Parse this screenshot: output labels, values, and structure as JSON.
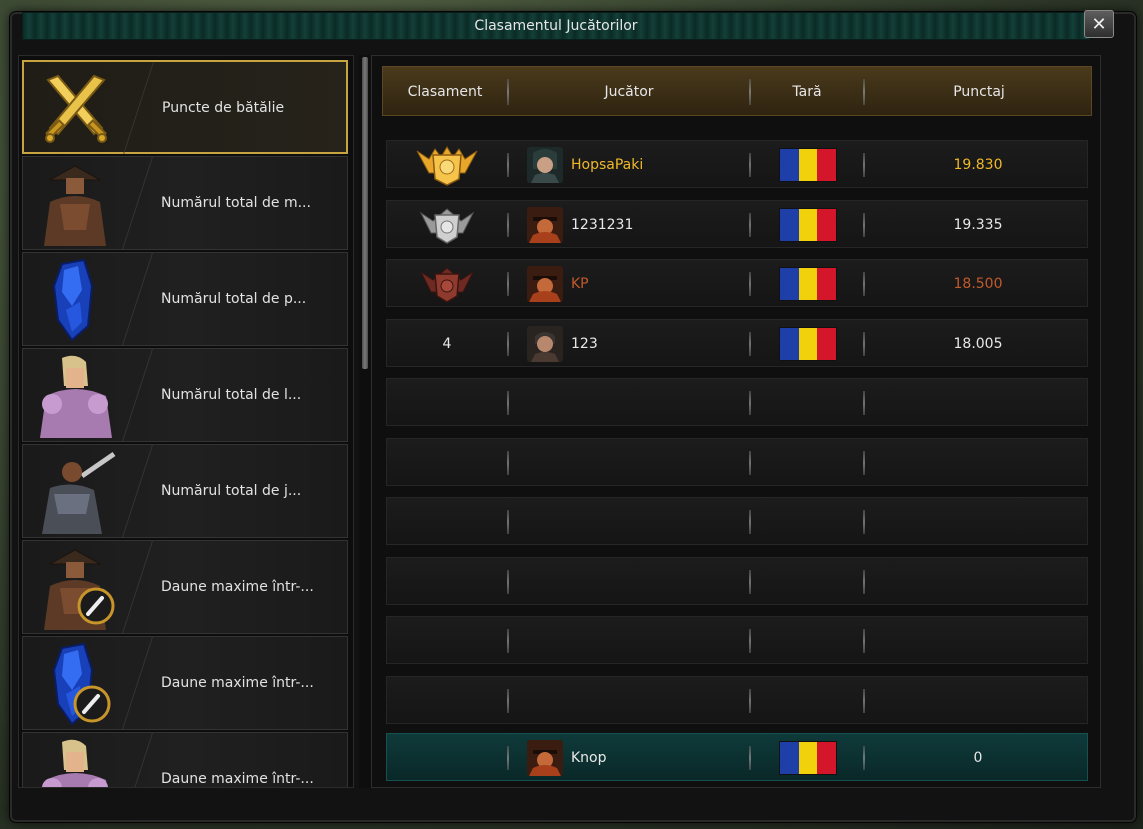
{
  "window": {
    "title": "Clasamentul Jucătorilor",
    "close_label": "✕"
  },
  "sidebar": {
    "items": [
      {
        "label": "Puncte de bătălie",
        "icon": "crossed-swords-icon",
        "active": true
      },
      {
        "label": "Numărul total de m...",
        "icon": "straw-hat-warrior-icon"
      },
      {
        "label": "Numărul total de p...",
        "icon": "blue-crystal-icon"
      },
      {
        "label": "Numărul total de l...",
        "icon": "paladin-icon"
      },
      {
        "label": "Numărul total de j...",
        "icon": "swordsman-icon"
      },
      {
        "label": "Daune maxime într-...",
        "icon": "straw-hat-warrior-sword-icon"
      },
      {
        "label": "Daune maxime într-...",
        "icon": "blue-crystal-sword-icon"
      },
      {
        "label": "Daune maxime într-...",
        "icon": "paladin-icon"
      }
    ]
  },
  "table": {
    "headers": {
      "rank": "Clasament",
      "player": "Jucător",
      "country": "Tară",
      "score": "Punctaj"
    },
    "rows": [
      {
        "rank": "",
        "rank_icon": "gold-medal-icon",
        "player": "HopsaPaki",
        "score": "19.830",
        "color": "#f0b92a",
        "avatar": "female-avatar"
      },
      {
        "rank": "",
        "rank_icon": "silver-medal-icon",
        "player": "1231231",
        "score": "19.335",
        "color": "#e8e8e8",
        "avatar": "warrior-avatar"
      },
      {
        "rank": "",
        "rank_icon": "bronze-medal-icon",
        "player": "KP",
        "score": "18.500",
        "color": "#c25a2a",
        "avatar": "warrior-avatar"
      },
      {
        "rank": "4",
        "rank_icon": "",
        "player": "123",
        "score": "18.005",
        "color": "#e8e8e8",
        "avatar": "male-avatar"
      }
    ],
    "empty_rows": 6,
    "self_row": {
      "player": "Knop",
      "score": "0",
      "avatar": "warrior-avatar"
    }
  },
  "flag_colors": [
    "#1e3ea8",
    "#f1d10b",
    "#d4162b"
  ]
}
